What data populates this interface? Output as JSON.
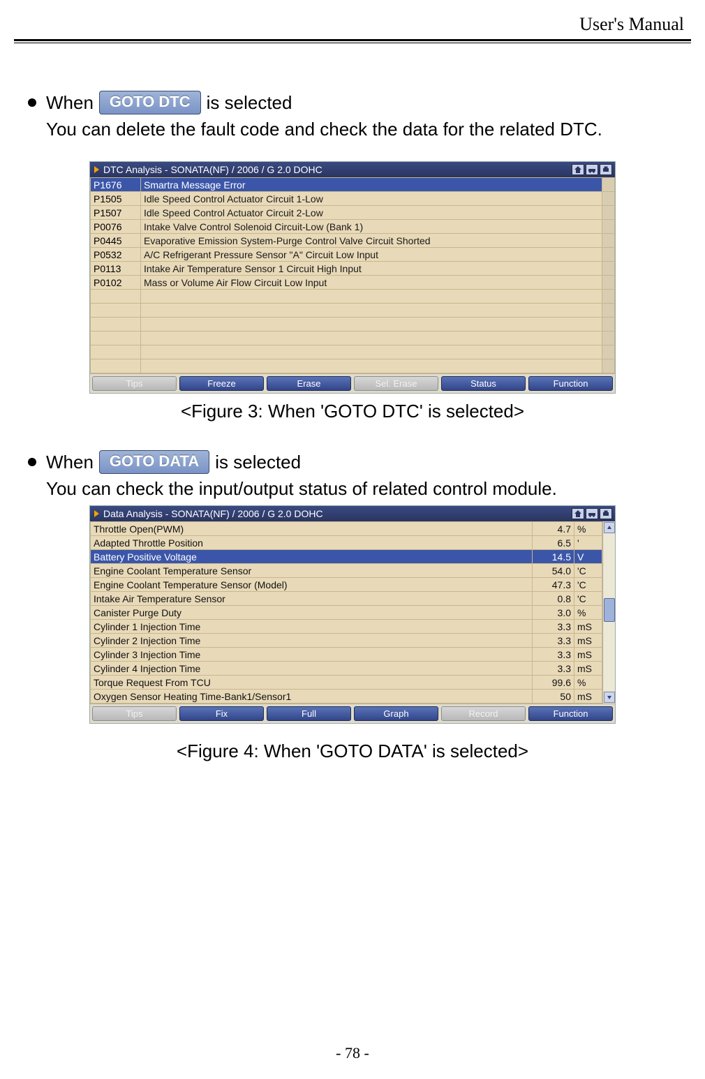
{
  "header_title": "User's Manual",
  "page_number": "- 78 -",
  "section1": {
    "when": "When",
    "button_label": "GOTO DTC",
    "is_selected": "is selected",
    "body": "You can delete the fault code and check the data for the related DTC.",
    "caption": "<Figure 3: When 'GOTO DTC' is selected>"
  },
  "section2": {
    "when": "When",
    "button_label": "GOTO DATA",
    "is_selected": "is selected",
    "body": "You can check the input/output status of related control module.",
    "caption": "<Figure 4: When 'GOTO DATA' is selected>"
  },
  "dtc_panel": {
    "title": "DTC Analysis - SONATA(NF) / 2006 / G 2.0 DOHC",
    "rows": [
      {
        "code": "P1676",
        "desc": "Smartra Message Error",
        "selected": true
      },
      {
        "code": "P1505",
        "desc": "Idle Speed Control Actuator Circuit 1-Low"
      },
      {
        "code": "P1507",
        "desc": "Idle Speed Control Actuator Circuit 2-Low"
      },
      {
        "code": "P0076",
        "desc": "Intake Valve Control Solenoid Circuit-Low (Bank 1)"
      },
      {
        "code": "P0445",
        "desc": "Evaporative Emission System-Purge Control Valve Circuit Shorted"
      },
      {
        "code": "P0532",
        "desc": "A/C Refrigerant Pressure Sensor \"A\" Circuit Low Input"
      },
      {
        "code": "P0113",
        "desc": "Intake Air Temperature Sensor 1 Circuit High Input"
      },
      {
        "code": "P0102",
        "desc": "Mass or Volume Air Flow Circuit Low Input"
      }
    ],
    "footer": [
      {
        "label": "Tips",
        "disabled": true
      },
      {
        "label": "Freeze"
      },
      {
        "label": "Erase"
      },
      {
        "label": "Sel. Erase",
        "disabled": true
      },
      {
        "label": "Status"
      },
      {
        "label": "Function"
      }
    ]
  },
  "data_panel": {
    "title": "Data Analysis - SONATA(NF) / 2006 / G 2.0 DOHC",
    "rows": [
      {
        "name": "Throttle Open(PWM)",
        "val": "4.7",
        "unit": "%"
      },
      {
        "name": "Adapted Throttle Position",
        "val": "6.5",
        "unit": "'"
      },
      {
        "name": "Battery Positive Voltage",
        "val": "14.5",
        "unit": "V",
        "selected": true
      },
      {
        "name": "Engine Coolant Temperature Sensor",
        "val": "54.0",
        "unit": "'C"
      },
      {
        "name": "Engine Coolant Temperature Sensor (Model)",
        "val": "47.3",
        "unit": "'C"
      },
      {
        "name": "Intake Air Temperature Sensor",
        "val": "0.8",
        "unit": "'C"
      },
      {
        "name": "Canister Purge Duty",
        "val": "3.0",
        "unit": "%"
      },
      {
        "name": "Cylinder 1 Injection Time",
        "val": "3.3",
        "unit": "mS"
      },
      {
        "name": "Cylinder 2 Injection Time",
        "val": "3.3",
        "unit": "mS"
      },
      {
        "name": "Cylinder 3 Injection Time",
        "val": "3.3",
        "unit": "mS"
      },
      {
        "name": "Cylinder 4 Injection Time",
        "val": "3.3",
        "unit": "mS"
      },
      {
        "name": "Torque Request From TCU",
        "val": "99.6",
        "unit": "%"
      },
      {
        "name": "Oxygen Sensor Heating Time-Bank1/Sensor1",
        "val": "50",
        "unit": "mS"
      }
    ],
    "footer": [
      {
        "label": "Tips",
        "disabled": true
      },
      {
        "label": "Fix"
      },
      {
        "label": "Full"
      },
      {
        "label": "Graph"
      },
      {
        "label": "Record",
        "disabled": true
      },
      {
        "label": "Function"
      }
    ]
  }
}
